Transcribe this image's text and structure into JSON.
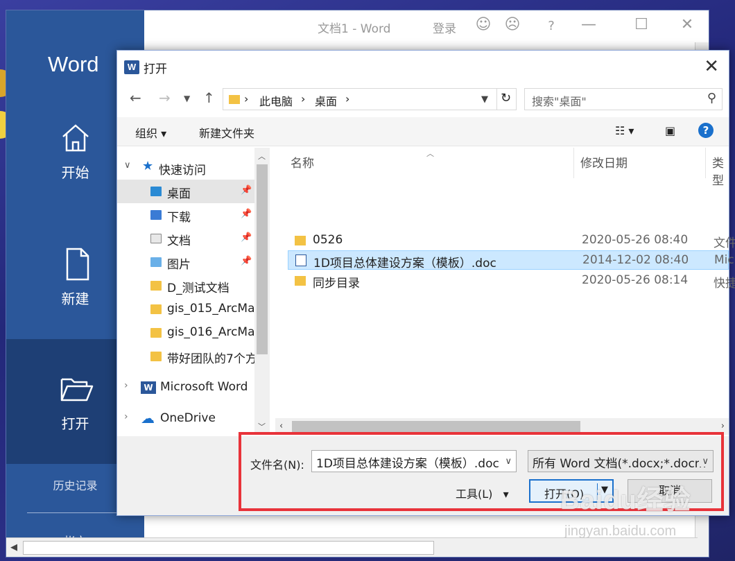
{
  "word": {
    "app_name": "Word",
    "window_title": "文档1  -  Word",
    "sign_in": "登录",
    "sidebar": {
      "home": "开始",
      "new": "新建",
      "open": "打开",
      "history": "历史记录",
      "account": "帐户"
    }
  },
  "dialog": {
    "title": "打开",
    "breadcrumb": [
      "此电脑",
      "桌面"
    ],
    "search_placeholder": "搜索\"桌面\"",
    "toolbar": {
      "organize": "组织",
      "new_folder": "新建文件夹"
    },
    "nav": {
      "quick_access": "快速访问",
      "items": [
        {
          "label": "桌面",
          "pinned": true,
          "selected": true
        },
        {
          "label": "下载",
          "pinned": true
        },
        {
          "label": "文档",
          "pinned": true
        },
        {
          "label": "图片",
          "pinned": true
        },
        {
          "label": "D_测试文档"
        },
        {
          "label": "gis_015_ArcMa"
        },
        {
          "label": "gis_016_ArcMa"
        },
        {
          "label": "带好团队的7个方"
        }
      ],
      "microsoft_word": "Microsoft Word",
      "onedrive": "OneDrive"
    },
    "columns": {
      "name": "名称",
      "modified": "修改日期",
      "type": "类型"
    },
    "files": [
      {
        "name": "0526",
        "modified": "2020-05-26 08:40",
        "type": "文件",
        "icon": "folder-icon"
      },
      {
        "name": "1D项目总体建设方案（模板）.doc",
        "modified": "2014-12-02 08:40",
        "type": "Mic",
        "icon": "word-doc-icon",
        "selected": true
      },
      {
        "name": "同步目录",
        "modified": "2020-05-26 08:14",
        "type": "快捷",
        "icon": "shortcut-folder-icon"
      }
    ],
    "file_name_label": "文件名(N):",
    "file_name_value": "1D项目总体建设方案（模板）.doc",
    "file_type_value": "所有 Word 文档(*.docx;*.docm",
    "tools": "工具(L)",
    "open_button": "打开(O)",
    "cancel_button": "取消"
  },
  "watermark": {
    "brand": "Baidu经验",
    "url": "jingyan.baidu.com"
  },
  "colors": {
    "word_blue": "#2b579a",
    "highlight_red": "#e8333a",
    "selection": "#cce8ff"
  }
}
